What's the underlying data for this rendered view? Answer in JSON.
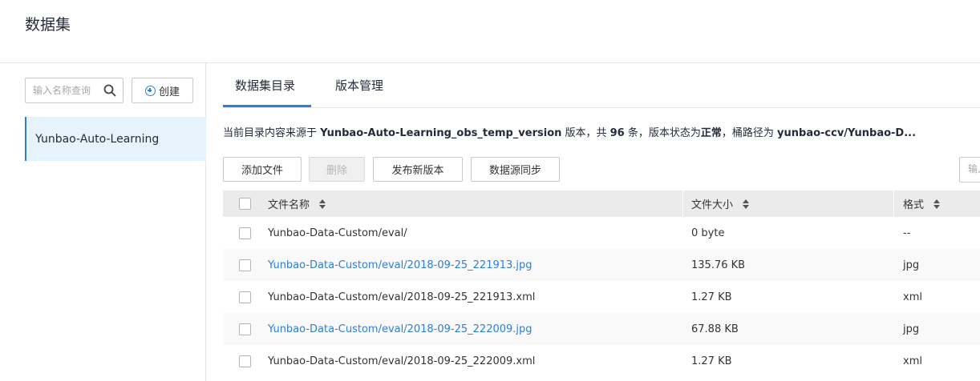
{
  "page": {
    "title": "数据集"
  },
  "sidebar": {
    "search_placeholder": "输入名称查询",
    "create_label": "创建",
    "items": [
      {
        "label": "Yunbao-Auto-Learning",
        "selected": true
      }
    ]
  },
  "tabs": [
    {
      "label": "数据集目录",
      "active": true
    },
    {
      "label": "版本管理",
      "active": false
    }
  ],
  "info": {
    "prefix": "当前目录内容来源于 ",
    "version_name": "Yunbao-Auto-Learning_obs_temp_version",
    "mid1": " 版本，共 ",
    "count": "96",
    "mid2": " 条，版本状态为",
    "status": "正常",
    "mid3": "，桶路径为 ",
    "path": "yunbao-ccv/Yunbao-D..."
  },
  "toolbar": {
    "add_file": "添加文件",
    "delete": "删除",
    "publish": "发布新版本",
    "sync": "数据源同步",
    "filter_placeholder": "输入"
  },
  "table": {
    "headers": {
      "name": "文件名称",
      "size": "文件大小",
      "format": "格式"
    },
    "rows": [
      {
        "name": "Yunbao-Data-Custom/eval/",
        "size": "0 byte",
        "format": "--",
        "link": false
      },
      {
        "name": "Yunbao-Data-Custom/eval/2018-09-25_221913.jpg",
        "size": "135.76 KB",
        "format": "jpg",
        "link": true
      },
      {
        "name": "Yunbao-Data-Custom/eval/2018-09-25_221913.xml",
        "size": "1.27 KB",
        "format": "xml",
        "link": false
      },
      {
        "name": "Yunbao-Data-Custom/eval/2018-09-25_222009.jpg",
        "size": "67.88 KB",
        "format": "jpg",
        "link": true
      },
      {
        "name": "Yunbao-Data-Custom/eval/2018-09-25_222009.xml",
        "size": "1.27 KB",
        "format": "xml",
        "link": false
      }
    ]
  },
  "colors": {
    "accent": "#2e7ed8",
    "selected_bg": "#e6f2fc",
    "header_bg": "#ebebeb"
  }
}
